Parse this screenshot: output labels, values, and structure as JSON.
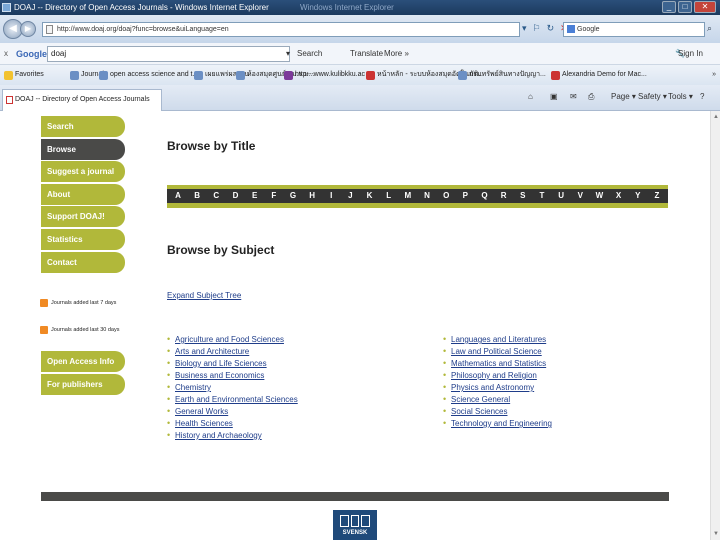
{
  "window": {
    "title": "DOAJ -- Directory of Open Access Journals - Windows Internet Explorer",
    "ghost_title": "Windows Internet Explorer"
  },
  "address": {
    "url": "http://www.doaj.org/doaj?func=browse&uiLanguage=en",
    "search_placeholder": "Google"
  },
  "google_toolbar": {
    "query": "doaj",
    "search_label": "Search",
    "translate_label": "Translate",
    "more_label": "More »",
    "signin_label": "Sign In"
  },
  "favorites": {
    "label": "Favorites",
    "items": [
      "Journals",
      "open access science and t...",
      "เผยแพร่ผลงาน",
      "ห้องสมุดศูนย์ฯ ม.ร ม...",
      "http---www.kulibkku.ac",
      "หน้าหลัก - ระบบห้องสมุดอัตโนมัติ...",
      "กรมทรัพย์สินทางปัญญา...",
      "Alexandria Demo for Mac..."
    ]
  },
  "tab": {
    "label": "DOAJ -- Directory of Open Access Journals"
  },
  "tab_tools": {
    "page": "Page ▾",
    "safety": "Safety ▾",
    "tools": "Tools ▾"
  },
  "nav": {
    "items": [
      "Search",
      "Browse",
      "Suggest a journal",
      "About",
      "Support DOAJ!",
      "Statistics",
      "Contact"
    ],
    "feeds": [
      "Journals added last 7 days",
      "Journals added last 30 days"
    ],
    "bottom": [
      "Open Access Info",
      "For publishers"
    ]
  },
  "content": {
    "browse_title": "Browse by Title",
    "letters": [
      "A",
      "B",
      "C",
      "D",
      "E",
      "F",
      "G",
      "H",
      "I",
      "J",
      "K",
      "L",
      "M",
      "N",
      "O",
      "P",
      "Q",
      "R",
      "S",
      "T",
      "U",
      "V",
      "W",
      "X",
      "Y",
      "Z"
    ],
    "browse_subject": "Browse by Subject",
    "expand_label": "Expand Subject Tree",
    "subjects_col1": [
      "Agriculture and Food Sciences",
      "Arts and Architecture",
      "Biology and Life Sciences",
      "Business and Economics",
      "Chemistry",
      "Earth and Environmental Sciences",
      "General Works",
      "Health Sciences",
      "History and Archaeology"
    ],
    "subjects_col2": [
      "Languages and Literatures",
      "Law and Political Science",
      "Mathematics and Statistics",
      "Philosophy and Religion",
      "Physics and Astronomy",
      "Science General",
      "Social Sciences",
      "Technology and Engineering"
    ]
  },
  "footer": {
    "logo_text": "SVENSK"
  },
  "colors": {
    "accent": "#b1b83a",
    "active_nav": "#4a4a48",
    "link": "#1f3d8a"
  }
}
